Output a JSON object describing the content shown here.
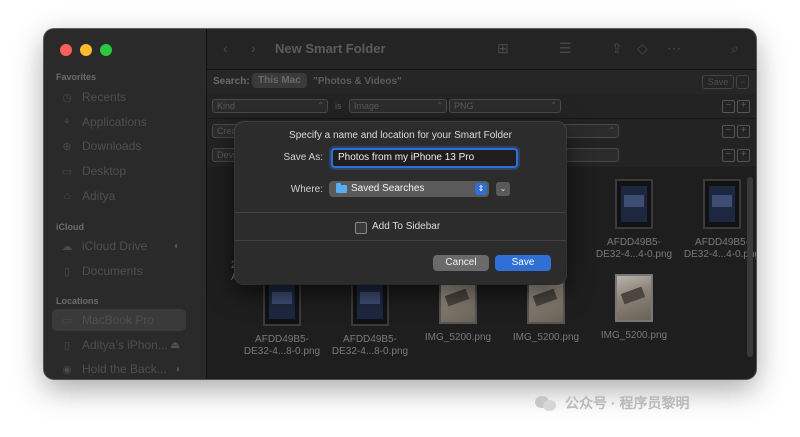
{
  "window": {
    "title": "New Smart Folder",
    "traffic_lights": [
      "#ff5f57",
      "#febc2e",
      "#28c840"
    ]
  },
  "sidebar": {
    "sections": [
      {
        "label": "Favorites",
        "items": [
          {
            "label": "Recents",
            "icon": "clock-icon"
          },
          {
            "label": "Applications",
            "icon": "applications-icon"
          },
          {
            "label": "Downloads",
            "icon": "download-icon"
          },
          {
            "label": "Desktop",
            "icon": "desktop-icon"
          },
          {
            "label": "Aditya",
            "icon": "home-icon"
          }
        ]
      },
      {
        "label": "iCloud",
        "items": [
          {
            "label": "iCloud Drive",
            "icon": "cloud-icon"
          },
          {
            "label": "Documents",
            "icon": "document-icon"
          }
        ]
      },
      {
        "label": "Locations",
        "items": [
          {
            "label": "MacBook Pro",
            "icon": "laptop-icon"
          },
          {
            "label": "Aditya’s iPhon...",
            "icon": "phone-icon"
          },
          {
            "label": "Hold the Back...",
            "icon": "disk-icon"
          }
        ]
      }
    ]
  },
  "search": {
    "label": "Search:",
    "scope_selected": "This Mac",
    "scope_other": "\"Photos & Videos\"",
    "save_label": "Save",
    "remove_label": "−"
  },
  "rules": [
    {
      "attribute": "Kind",
      "operator": "is",
      "value": "Image",
      "subvalue": "PNG"
    },
    {
      "attribute": "Crea"
    },
    {
      "attribute": "Devi"
    }
  ],
  "files": [
    {
      "name": "AFDD49B5-\nDE32-4...4-0.png",
      "kind": "screenshot"
    },
    {
      "name": "AFDD49B5-\nDE32-4...4-0.png",
      "kind": "screenshot"
    },
    {
      "name": "AFDD49B5-\nDE32-4...8-0.png",
      "kind": "screenshot"
    },
    {
      "name": "AFDD49B5-\nDE32-4...8-0.png",
      "kind": "screenshot"
    },
    {
      "name": "IMG_5200.png",
      "kind": "photo"
    },
    {
      "name": "IMG_5200.png",
      "kind": "photo"
    },
    {
      "name": "IMG_5200.png",
      "kind": "photo"
    }
  ],
  "partial_file_labels": [
    "2",
    "AAE"
  ],
  "dialog": {
    "title": "Specify a name and location for your Smart Folder",
    "save_as_label": "Save As:",
    "save_as_value": "Photos from my iPhone 13 Pro",
    "where_label": "Where:",
    "where_value": "Saved Searches",
    "sidebar_checkbox_label": "Add To Sidebar",
    "sidebar_checked": false,
    "cancel_label": "Cancel",
    "save_label": "Save",
    "accent_color": "#2f6fd6"
  },
  "watermark": {
    "text": "公众号 · 程序员黎明"
  }
}
